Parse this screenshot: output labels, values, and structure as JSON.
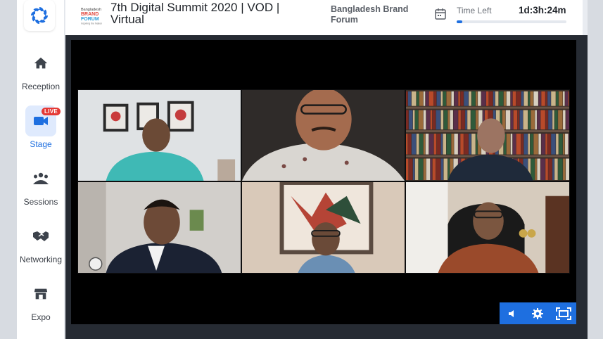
{
  "sidebar": {
    "items": [
      {
        "label": "Reception",
        "icon": "home-icon"
      },
      {
        "label": "Stage",
        "icon": "video-camera-icon",
        "badge": "LIVE"
      },
      {
        "label": "Sessions",
        "icon": "people-group-icon"
      },
      {
        "label": "Networking",
        "icon": "handshake-icon"
      },
      {
        "label": "Expo",
        "icon": "storefront-icon"
      }
    ]
  },
  "header": {
    "title": "7th Digital Summit 2020 | VOD | Virtual",
    "organizer": "Bangladesh Brand Forum",
    "time_left_label": "Time Left",
    "time_left_value": "1d:3h:24m",
    "time_progress": 0.05
  },
  "player": {
    "controls": [
      "volume-icon",
      "settings-icon",
      "fullscreen-icon"
    ]
  },
  "colors": {
    "accent": "#1e6fe0",
    "live": "#e53935",
    "player_bg": "#000000"
  }
}
